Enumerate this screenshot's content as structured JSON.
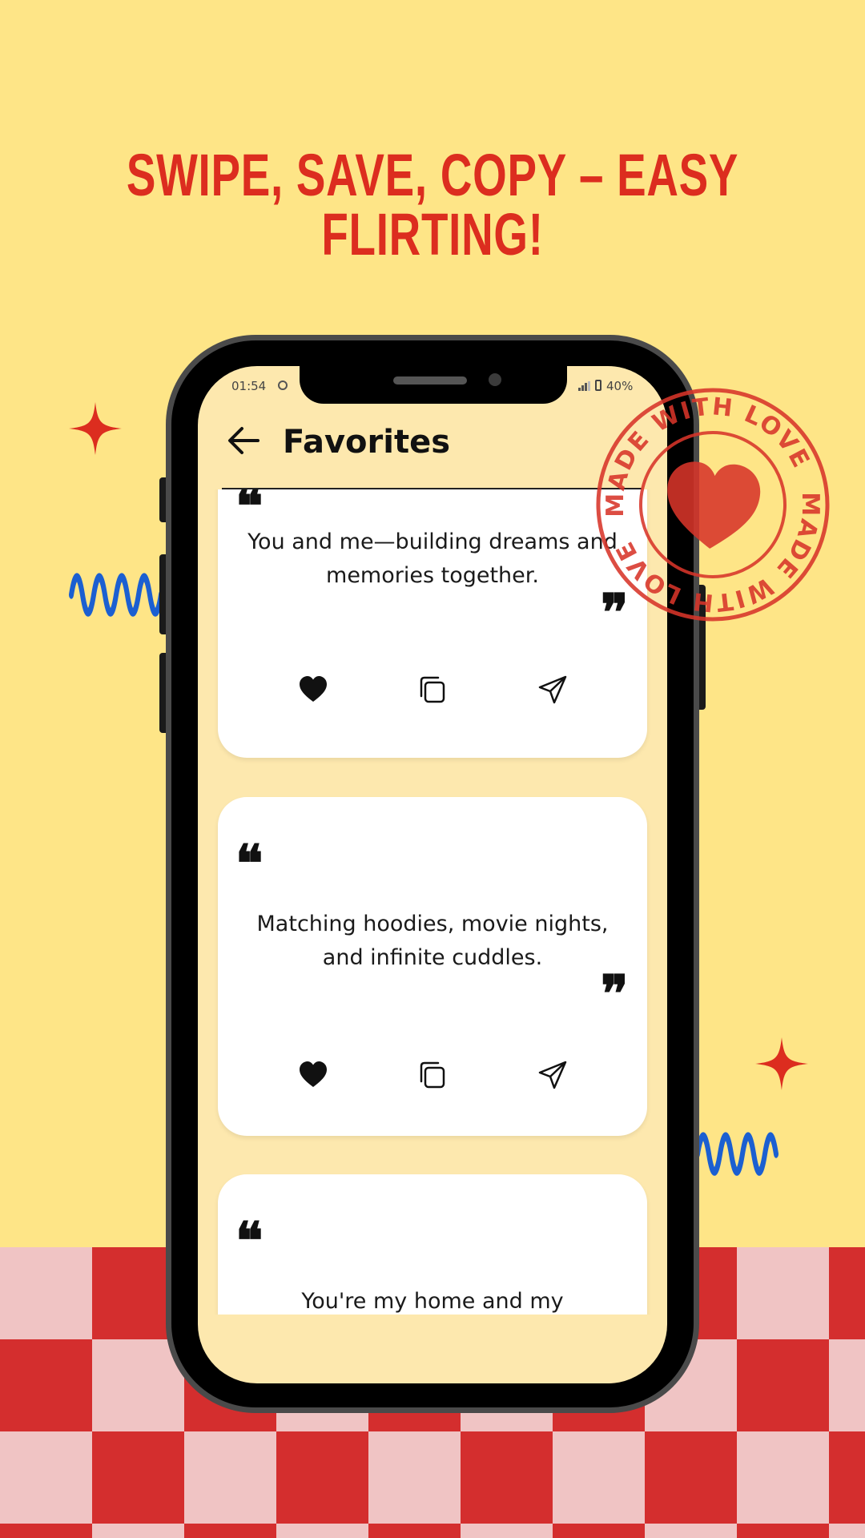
{
  "headline": "SWIPE, SAVE, COPY – EASY FLIRTING!",
  "stamp": {
    "ring_text": "MADE WITH LOVE",
    "icon": "heart-icon"
  },
  "status_bar": {
    "time": "01:54",
    "battery": "40%"
  },
  "app_bar": {
    "title": "Favorites",
    "back_icon": "arrow-left-icon"
  },
  "quotes": [
    {
      "text": "You and me—building dreams and memories together."
    },
    {
      "text": "Matching hoodies, movie nights, and infinite cuddles."
    },
    {
      "text": "You're my home and my"
    }
  ],
  "card_actions": {
    "like_icon": "heart-icon",
    "copy_icon": "copy-icon",
    "share_icon": "send-icon"
  },
  "colors": {
    "background": "#fee587",
    "headline": "#dc2d1f",
    "accent_red": "#d42e2e",
    "squiggle_blue": "#1b5fd1",
    "screen": "#fde8ae",
    "card": "#ffffff"
  }
}
